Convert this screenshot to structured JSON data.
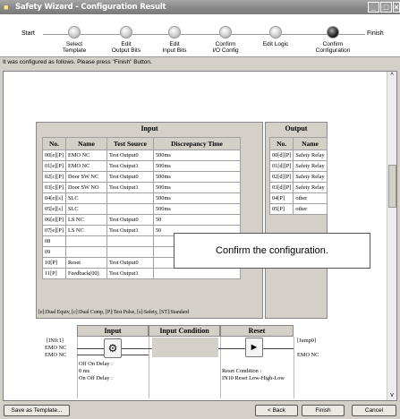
{
  "window": {
    "title": "Safety Wizard - Configuration Result"
  },
  "steps": {
    "start": "Start",
    "finish": "Finish",
    "items": [
      "Select\nTemplate",
      "Edit\nOutput Bits",
      "Edit\nInput Bits",
      "Confirm\nI/O Config",
      "Edit Logic",
      "Confirm\nConfiguration"
    ]
  },
  "info": "It was configured as follows. Please press \"Finish\" Button.",
  "input": {
    "title": "Input",
    "headers": [
      "No.",
      "Name",
      "Test Source",
      "Discrepancy Time"
    ],
    "rows": [
      [
        "00[e][P]",
        "EMO NC",
        "Test Output0",
        "500ms"
      ],
      [
        "01[e][P]",
        "EMO NC",
        "Test Output1",
        "500ms"
      ],
      [
        "02[c][P]",
        "Door SW NC",
        "Test Output0",
        "500ms"
      ],
      [
        "03[c][P]",
        "Door SW NO",
        "Test Output1",
        "500ms"
      ],
      [
        "04[e][s]",
        "SLC",
        "",
        "500ms"
      ],
      [
        "05[e][s]",
        "SLC",
        "",
        "500ms"
      ],
      [
        "06[e][P]",
        "LS NC",
        "Test Output0",
        "50"
      ],
      [
        "07[e][P]",
        "LS NC",
        "Test Output1",
        "50"
      ],
      [
        "08",
        "",
        "",
        ""
      ],
      [
        "09",
        "",
        "",
        ""
      ],
      [
        "10[P]",
        "Reset",
        "Test Output0",
        ""
      ],
      [
        "11[P]",
        "Feedback(00)",
        "Test Output1",
        ""
      ]
    ]
  },
  "output": {
    "title": "Output",
    "headers": [
      "No.",
      "Name"
    ],
    "rows": [
      [
        "00[d][P]",
        "Safety Relay"
      ],
      [
        "01[d][P]",
        "Safety Relay"
      ],
      [
        "02[d][P]",
        "Safety Relay"
      ],
      [
        "03[d][P]",
        "Safety Relay"
      ],
      [
        "04[P]",
        "other"
      ],
      [
        "05[P]",
        "other"
      ]
    ]
  },
  "legend": "[e]:Dual Equiv, [c]:Dual Comp, [P]:Test Pulse, [s]:Safety, [ST]:Standard",
  "overlay": "Confirm the configuration.",
  "ladder": {
    "headers": [
      "Input",
      "Input Condition",
      "Reset"
    ],
    "input_labels": [
      "[IN0:1]",
      "EMO NC",
      "EMO NC"
    ],
    "jump": "[Jump0]",
    "out_name": "EMO NC",
    "delay": [
      "Off On Delay :",
      "0 ms",
      "On Off Delay :"
    ],
    "reset": [
      "Reset Condition :",
      "IN10 Reset Low-High-Low"
    ]
  },
  "buttons": {
    "save_template": "Save as Template...",
    "back": "< Back",
    "finish": "Finish",
    "cancel": "Cancel"
  }
}
